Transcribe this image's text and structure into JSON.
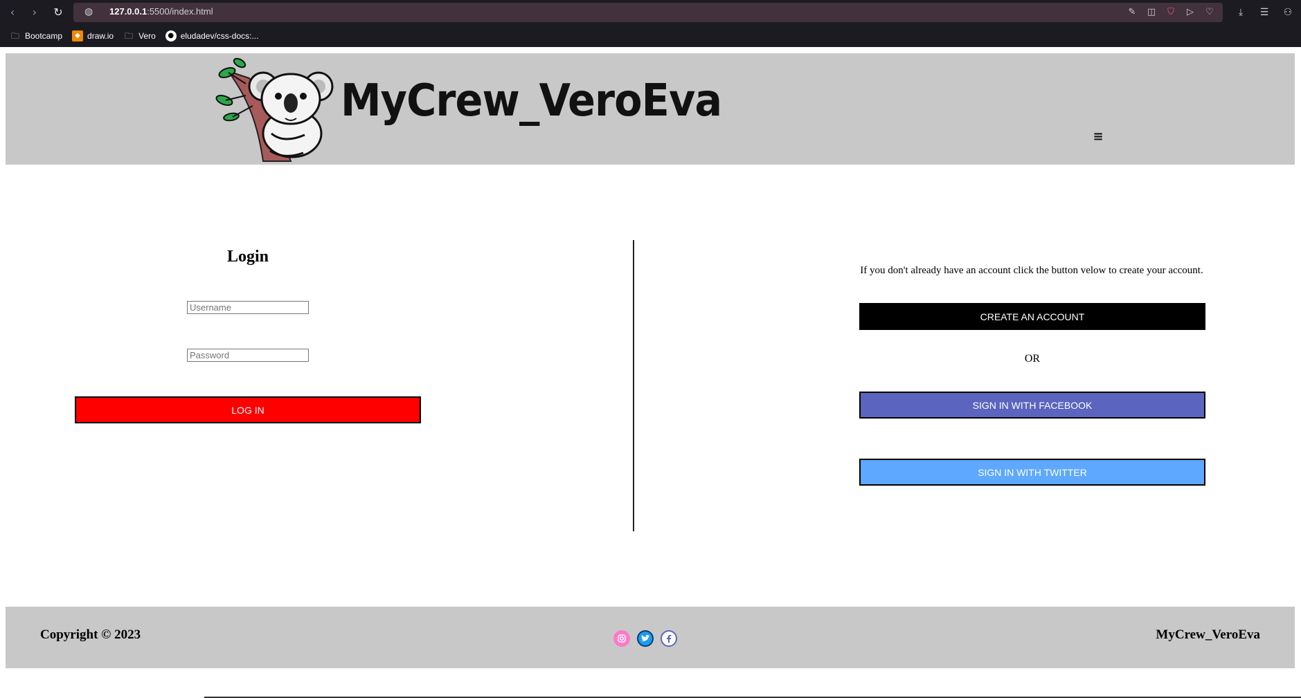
{
  "browser": {
    "url_host": "127.0.0.1",
    "url_path": ":5500/index.html",
    "bookmarks": [
      {
        "label": "Bootcamp",
        "icon": "folder-icon"
      },
      {
        "label": "draw.io",
        "icon": "drawio-icon"
      },
      {
        "label": "Vero",
        "icon": "folder-icon"
      },
      {
        "label": "eludadev/css-docs:...",
        "icon": "github-icon"
      }
    ]
  },
  "header": {
    "brand": "MyCrew_VeroEva",
    "logo_icon": "koala-on-tree-icon",
    "menu_icon": "≡"
  },
  "login": {
    "title": "Login",
    "username_placeholder": "Username",
    "password_placeholder": "Password",
    "submit_label": "LOG IN",
    "submit_color": "#ff0000"
  },
  "signup": {
    "info": "If you don't already have an account click the button velow to create your account.",
    "create_label": "CREATE AN ACCOUNT",
    "or_text": "OR",
    "facebook_label": "SIGN IN WITH FACEBOOK",
    "twitter_label": "SIGN IN WITH TWITTER",
    "colors": {
      "create": "#000000",
      "facebook": "#5b64bf",
      "twitter": "#5ea8ff"
    }
  },
  "footer": {
    "copyright": "Copyright © 2023",
    "brand": "MyCrew_VeroEva",
    "socials": [
      "instagram-icon",
      "twitter-icon",
      "facebook-icon"
    ]
  }
}
